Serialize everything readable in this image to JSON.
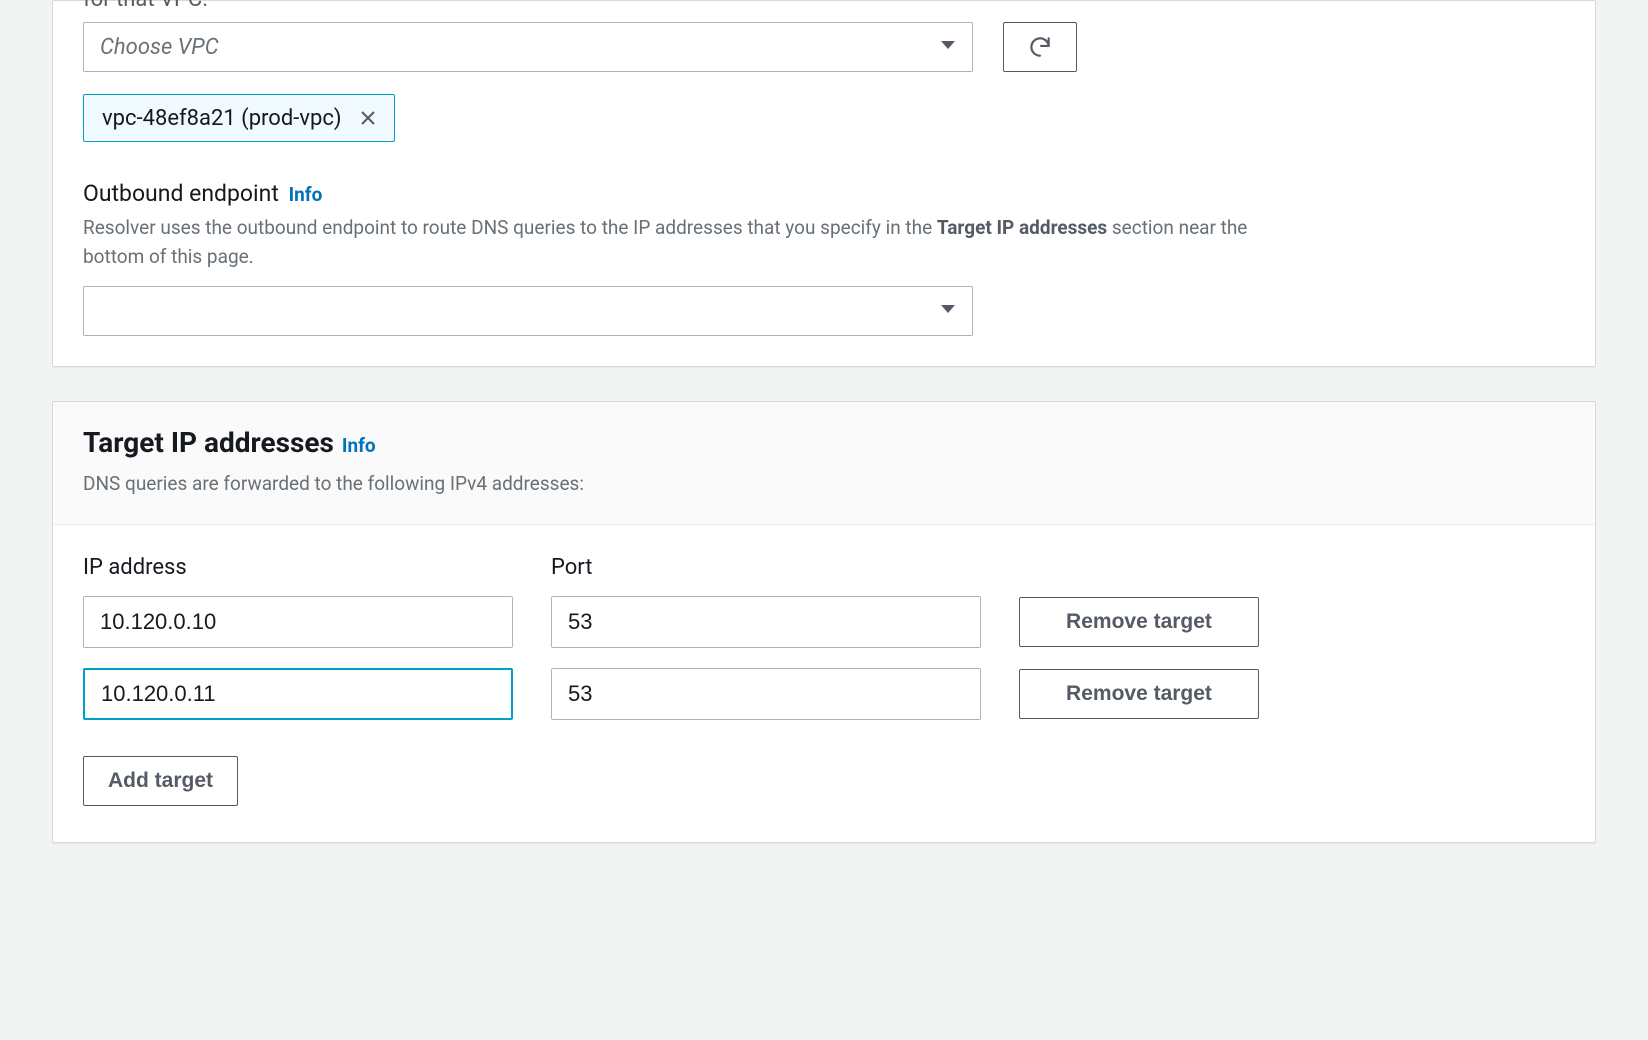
{
  "vpc_section": {
    "clipped_hint": "for that VPC.",
    "select_placeholder": "Choose VPC",
    "selected_chip": "vpc-48ef8a21 (prod-vpc)"
  },
  "outbound": {
    "label": "Outbound endpoint",
    "info": "Info",
    "help_pre": "Resolver uses the outbound endpoint to route DNS queries to the IP addresses that you specify in the ",
    "help_bold": "Target IP addresses",
    "help_post": " section near the bottom of this page.",
    "select_value": ""
  },
  "targets": {
    "title": "Target IP addresses",
    "info": "Info",
    "subtitle": "DNS queries are forwarded to the following IPv4 addresses:",
    "columns": {
      "ip": "IP address",
      "port": "Port"
    },
    "rows": [
      {
        "ip": "10.120.0.10",
        "port": "53",
        "focused": false
      },
      {
        "ip": "10.120.0.11",
        "port": "53",
        "focused": true
      }
    ],
    "remove_label": "Remove target",
    "add_label": "Add target"
  }
}
